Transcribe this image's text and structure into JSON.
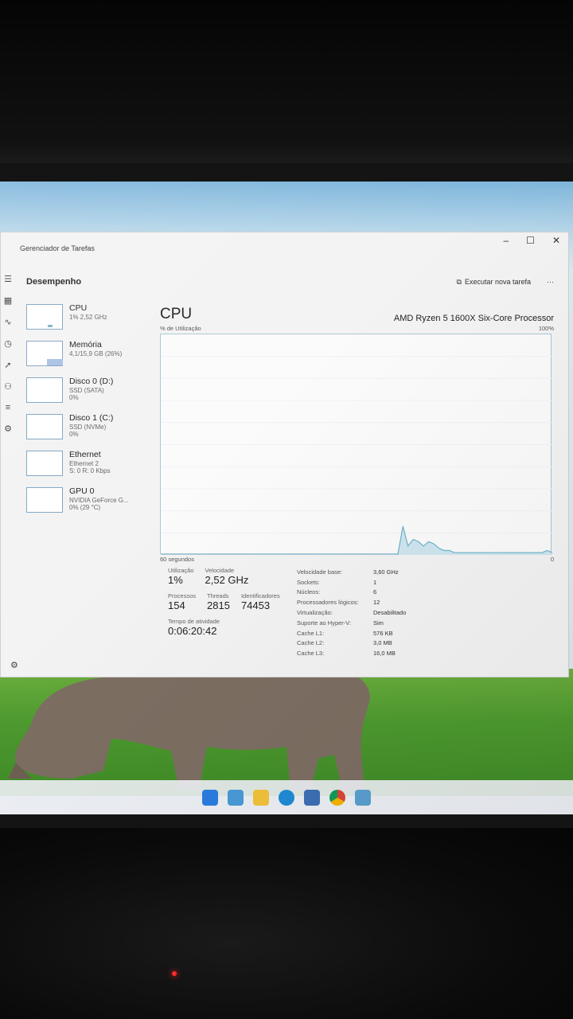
{
  "window": {
    "title": "Gerenciador de Tarefas",
    "section": "Desempenho",
    "run_task_label": "Executar nova tarefa",
    "more_label": "···"
  },
  "sidebar": {
    "items": [
      {
        "label": "CPU",
        "sub1": "1% 2,52 GHz",
        "sub2": ""
      },
      {
        "label": "Memória",
        "sub1": "4,1/15,9 GB (26%)",
        "sub2": ""
      },
      {
        "label": "Disco 0 (D:)",
        "sub1": "SSD (SATA)",
        "sub2": "0%"
      },
      {
        "label": "Disco 1 (C:)",
        "sub1": "SSD (NVMe)",
        "sub2": "0%"
      },
      {
        "label": "Ethernet",
        "sub1": "Ethernet 2",
        "sub2": "S: 0 R: 0 Kbps"
      },
      {
        "label": "GPU 0",
        "sub1": "NVIDIA GeForce G...",
        "sub2": "0% (29 °C)"
      }
    ]
  },
  "main": {
    "title": "CPU",
    "processor": "AMD Ryzen 5 1600X Six-Core Processor",
    "y_label": "% de Utilização",
    "y_max": "100%",
    "x_label": "60 segundos",
    "x_min": "0"
  },
  "stats": {
    "utilization_label": "Utilização",
    "utilization_value": "1%",
    "speed_label": "Velocidade",
    "speed_value": "2,52 GHz",
    "processes_label": "Processos",
    "processes_value": "154",
    "threads_label": "Threads",
    "threads_value": "2815",
    "handles_label": "Identificadores",
    "handles_value": "74453",
    "uptime_label": "Tempo de atividade",
    "uptime_value": "0:06:20:42"
  },
  "details": [
    {
      "key": "Velocidade base:",
      "value": "3,60 GHz"
    },
    {
      "key": "Sockets:",
      "value": "1"
    },
    {
      "key": "Núcleos:",
      "value": "6"
    },
    {
      "key": "Processadores lógicos:",
      "value": "12"
    },
    {
      "key": "Virtualização:",
      "value": "Desabilitado"
    },
    {
      "key": "Suporte ao Hyper-V:",
      "value": "Sim"
    },
    {
      "key": "Cache L1:",
      "value": "576 KB"
    },
    {
      "key": "Cache L2:",
      "value": "3,0 MB"
    },
    {
      "key": "Cache L3:",
      "value": "16,0 MB"
    }
  ],
  "cpu_history": [
    0,
    0,
    0,
    0,
    0,
    0,
    0,
    0,
    0,
    0,
    0,
    0,
    0,
    0,
    0,
    0,
    0,
    0,
    0,
    0,
    0,
    0,
    0,
    0,
    0,
    0,
    0,
    0,
    0,
    0,
    0,
    0,
    0,
    0,
    0,
    0,
    0,
    0,
    0,
    0,
    0,
    0,
    0,
    0,
    0,
    0,
    0,
    13,
    4,
    7,
    6,
    4,
    6,
    5,
    3,
    2,
    2,
    1,
    1,
    1,
    1,
    1,
    1,
    1,
    1,
    1,
    1,
    1,
    1,
    1,
    1,
    1,
    1,
    1,
    1,
    2,
    1
  ],
  "colors": {
    "graph_line": "#6fb3cc",
    "graph_fill": "#cfe6ef"
  }
}
